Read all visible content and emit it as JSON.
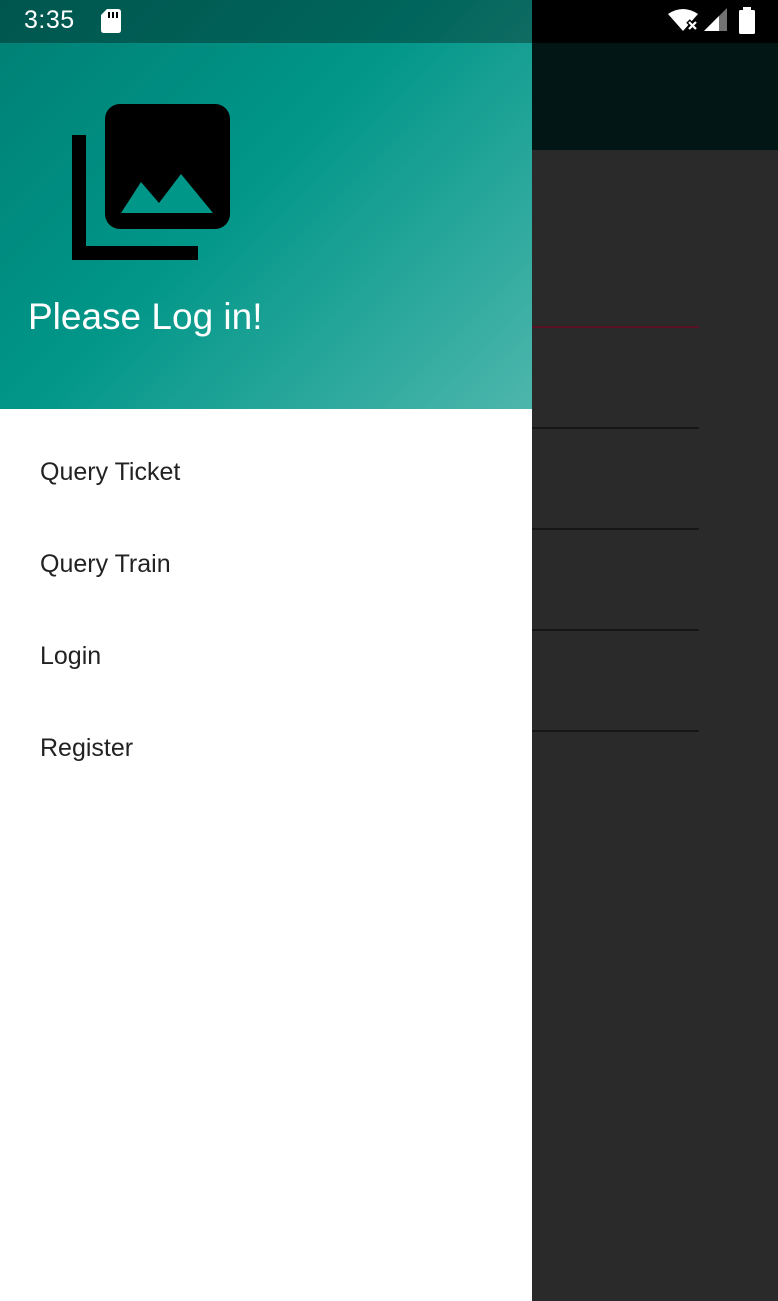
{
  "status_bar": {
    "time": "3:35"
  },
  "drawer": {
    "header": {
      "title": "Please Log in!",
      "icon": "photo-library-icon"
    },
    "menu": [
      {
        "label": "Query Ticket"
      },
      {
        "label": "Query Train"
      },
      {
        "label": "Login"
      },
      {
        "label": "Register"
      }
    ]
  },
  "colors": {
    "header_gradient_start": "#007f74",
    "header_gradient_mid": "#009688",
    "header_gradient_end": "#4db6ac",
    "background_app": "#2a2a2a",
    "background_toolbar": "#011615",
    "accent_line": "#5a1126",
    "menu_text": "#222222"
  }
}
